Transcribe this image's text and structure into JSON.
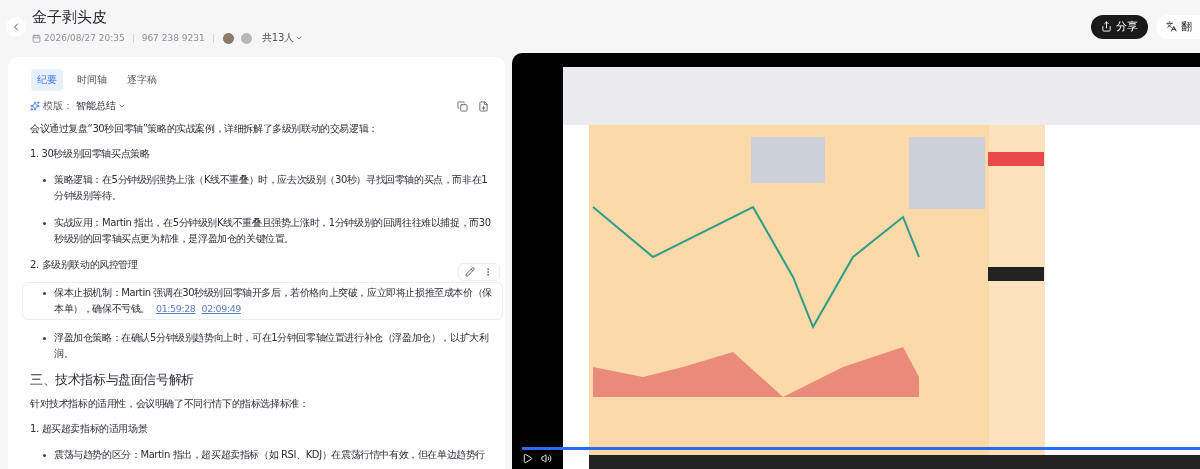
{
  "header": {
    "title": "金子剥头皮",
    "date": "2026/08/27 20:35",
    "meeting_id": "967 238 9231",
    "participants": "共13人"
  },
  "actions": [
    {
      "label": "分享",
      "kind": "primary"
    },
    {
      "label": "翻",
      "kind": "secondary"
    }
  ],
  "tabs": [
    {
      "label": "纪要",
      "selected": true
    },
    {
      "label": "时间轴",
      "selected": false
    },
    {
      "label": "逐字稿",
      "selected": false
    }
  ],
  "template": {
    "label": "模版：",
    "value": "智能总结"
  },
  "summary": [
    {
      "kind": "paragraph",
      "text": "会议通过复盘“30秒回零轴”策略的实战案例，详细拆解了多级别联动的交易逻辑："
    },
    {
      "kind": "subheading",
      "text": "1. 30秒级别回零轴买点策略"
    },
    {
      "kind": "bullet",
      "text": "策略逻辑：在5分钟级别强势上涨（K线不重叠）时，应去次级别（30秒）寻找回零轴的买点，而非在1分钟级别等待。",
      "highlighted": false
    },
    {
      "kind": "bullet",
      "text": "实战应用：Martin 指出，在5分钟级别K线不重叠且强势上涨时，1分钟级别的回调往往难以捕捉，而30秒级别的回零轴买点更为精准，是浮盈加仓的关键位置。",
      "highlighted": false
    },
    {
      "kind": "subheading",
      "text": "2. 多级别联动的风控管理"
    },
    {
      "kind": "bullet",
      "text": "保本止损机制：Martin 强调在30秒级别回零轴开多后，若价格向上突破，应立即将止损推至成本价（保本单），确保不亏钱。",
      "highlighted": true,
      "timestamps": [
        "01:59:28",
        "02:09:49"
      ]
    },
    {
      "kind": "bullet",
      "text": "浮盈加仓策略：在确认5分钟级别趋势向上时，可在1分钟回零轴位置进行补仓（浮盈加仓），以扩大利润。",
      "highlighted": false
    },
    {
      "kind": "heading",
      "text": "三、技术指标与盘面信号解析"
    },
    {
      "kind": "paragraph",
      "text": "针对技术指标的适用性，会议明确了不同行情下的指标选择标准："
    },
    {
      "kind": "subheading",
      "text": "1. 超买超卖指标的适用场景"
    },
    {
      "kind": "bullet",
      "text": "震荡与趋势的区分：Martin 指出，超买超卖指标（如 RSI、KDJ）在震荡行情中有效，但在单边趋势行",
      "highlighted": false
    }
  ],
  "video": {
    "kind": "picture",
    "level": 1
  }
}
